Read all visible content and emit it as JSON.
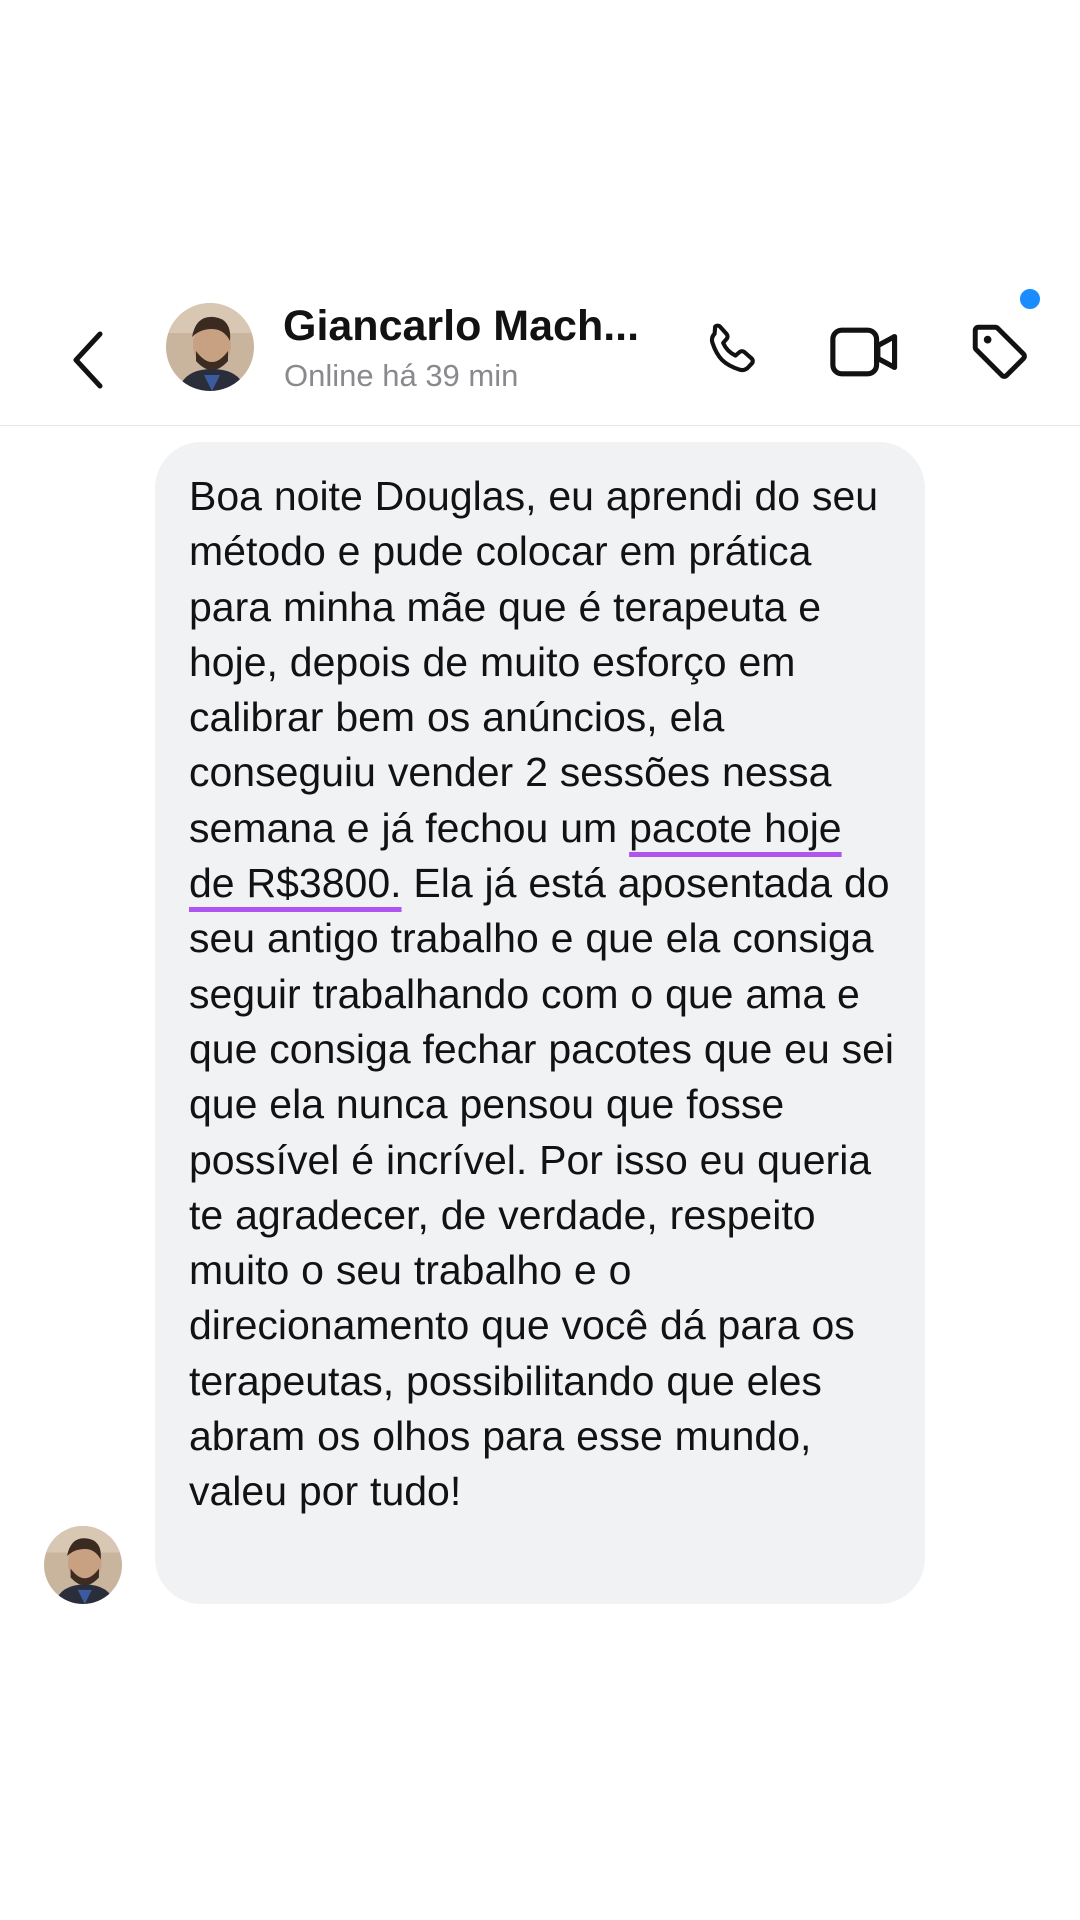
{
  "header": {
    "contact_name": "Giancarlo Mach...",
    "status": "Online há 39 min",
    "icons": {
      "back": "chevron-left-icon",
      "call": "phone-icon",
      "video": "video-camera-icon",
      "tag": "tag-icon"
    },
    "notification_dot_color": "#1a8cff"
  },
  "message": {
    "text_before": "Boa noite Douglas, eu aprendi do seu método e pude colocar em prática para minha mãe que é terapeuta e hoje, depois de muito esforço em calibrar bem os anúncios, ela conseguiu vender 2 sessões nessa semana e já fechou um ",
    "text_highlight": "pacote hoje de R$3800.",
    "text_after": " Ela já está aposentada do seu antigo trabalho e que ela consiga seguir trabalhando com o que ama e que consiga fechar pacotes que eu sei que ela nunca pensou que fosse possível é incrível. Por isso eu queria te agradecer, de verdade, respeito muito o seu trabalho e o direcionamento que você dá para os terapeutas, possibilitando que eles abram os olhos para esse mundo, valeu por tudo!",
    "highlight_color": "#b054f0",
    "bubble_color": "#f1f2f4"
  }
}
